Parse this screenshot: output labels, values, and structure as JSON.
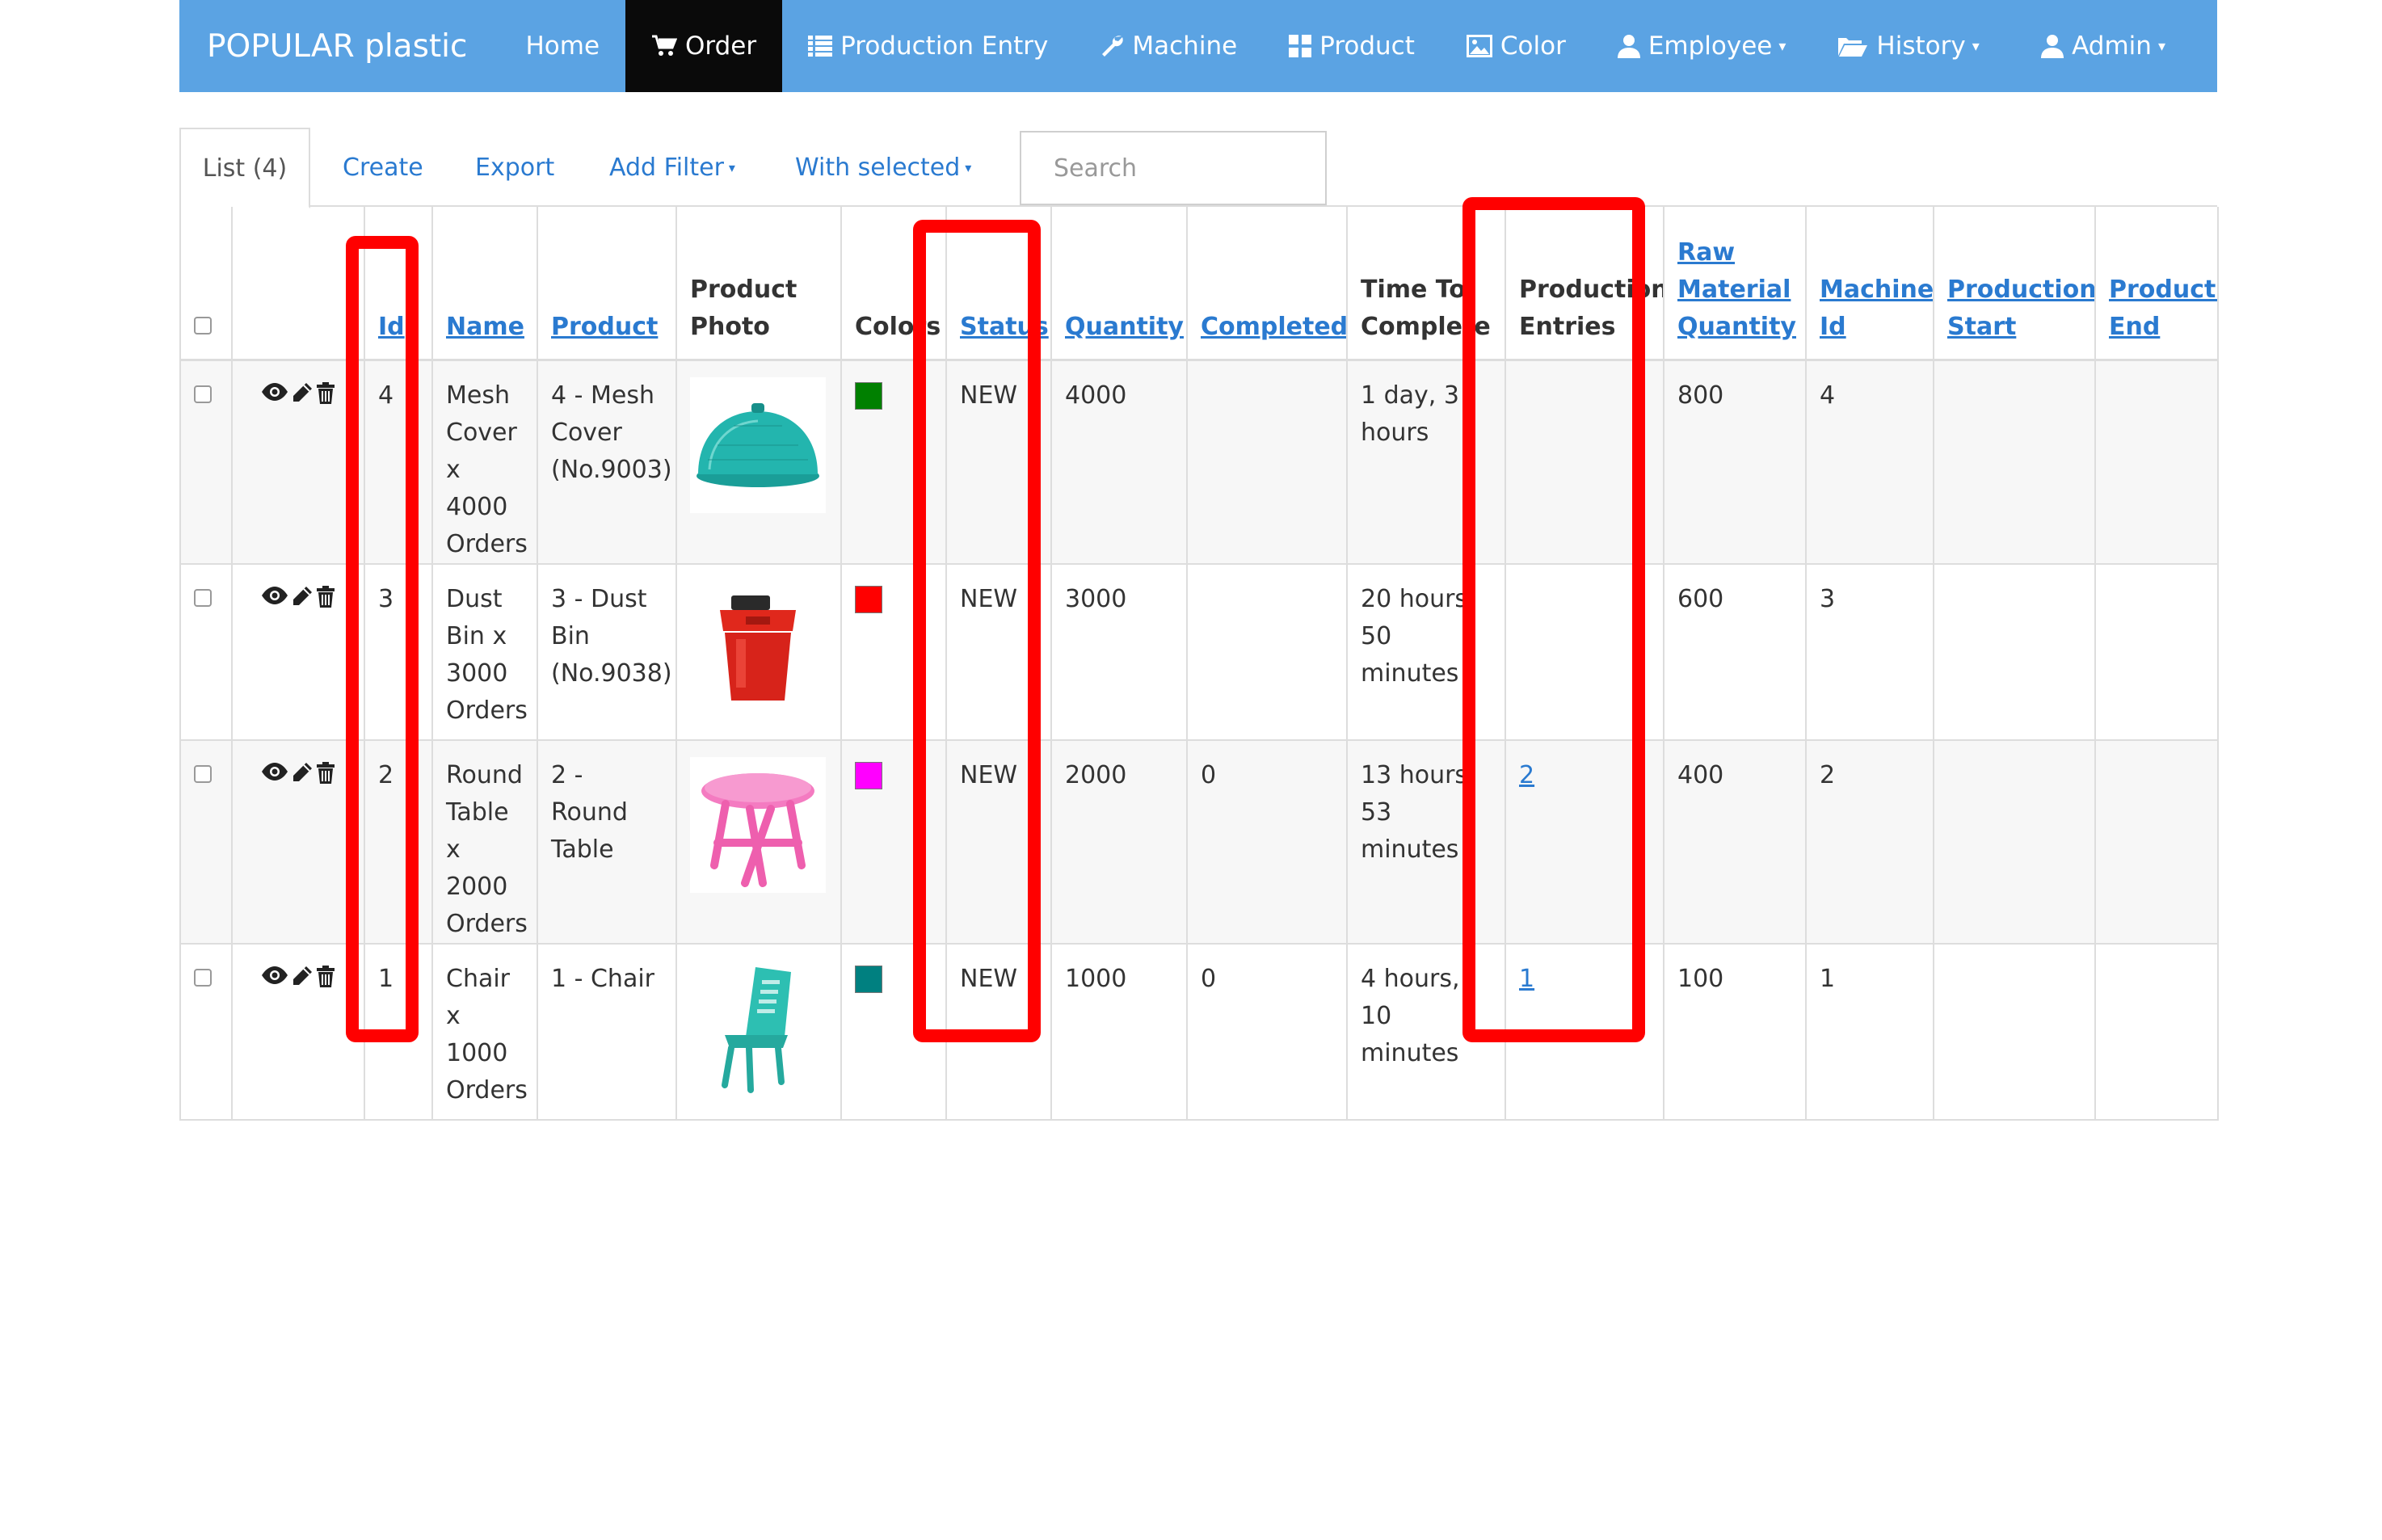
{
  "navbar": {
    "brand": "POPULAR plastic",
    "items": [
      {
        "label": "Home",
        "icon": "",
        "active": false
      },
      {
        "label": "Order",
        "icon": "cart-icon",
        "active": true
      },
      {
        "label": "Production Entry",
        "icon": "list-icon",
        "active": false
      },
      {
        "label": "Machine",
        "icon": "wrench-icon",
        "active": false
      },
      {
        "label": "Product",
        "icon": "grid-icon",
        "active": false
      },
      {
        "label": "Color",
        "icon": "picture-icon",
        "active": false
      },
      {
        "label": "Employee",
        "icon": "user-icon",
        "active": false,
        "dropdown": true
      },
      {
        "label": "History",
        "icon": "folder-icon",
        "active": false,
        "dropdown": true
      }
    ],
    "admin": {
      "label": "Admin",
      "icon": "user-icon",
      "dropdown": true
    },
    "color": "#5ba3e3",
    "active_color": "#0a0a0a"
  },
  "tabs": {
    "list": "List (4)",
    "create": "Create",
    "export": "Export",
    "add_filter": "Add Filter",
    "with_selected": "With selected"
  },
  "search": {
    "placeholder": "Search"
  },
  "table": {
    "headers": {
      "id": "Id",
      "name": "Name",
      "product": "Product",
      "product_photo": "Product Photo",
      "colors": "Colors",
      "status": "Status",
      "quantity": "Quantity",
      "completed": "Completed",
      "time_to_complete": "Time To Complete",
      "production_entries": "Production Entries",
      "raw_material_quantity": "Raw Material Quantity",
      "machine_id": "Machine Id",
      "production_start": "Production Start",
      "production_end": "Production End"
    },
    "rows": [
      {
        "id": "4",
        "name": "Mesh Cover x 4000 Orders",
        "product": "4 - Mesh Cover (No.9003)",
        "photo": "mesh-cover-image",
        "color": "#008000",
        "status": "NEW",
        "quantity": "4000",
        "completed": "",
        "time_to_complete": "1 day, 3 hours",
        "production_entries": "",
        "raw_material_quantity": "800",
        "machine_id": "4",
        "production_start": "",
        "production_end": ""
      },
      {
        "id": "3",
        "name": "Dust Bin x 3000 Orders",
        "product": "3 - Dust Bin (No.9038)",
        "photo": "dust-bin-image",
        "color": "#ff0000",
        "status": "NEW",
        "quantity": "3000",
        "completed": "",
        "time_to_complete": "20 hours, 50 minutes",
        "production_entries": "",
        "raw_material_quantity": "600",
        "machine_id": "3",
        "production_start": "",
        "production_end": ""
      },
      {
        "id": "2",
        "name": "Round Table x 2000 Orders",
        "product": "2 - Round Table",
        "photo": "round-table-image",
        "color": "#ff00ff",
        "status": "NEW",
        "quantity": "2000",
        "completed": "0",
        "time_to_complete": "13 hours, 53 minutes",
        "production_entries": "2",
        "raw_material_quantity": "400",
        "machine_id": "2",
        "production_start": "",
        "production_end": ""
      },
      {
        "id": "1",
        "name": "Chair x 1000 Orders",
        "product": "1 - Chair",
        "photo": "chair-image",
        "color": "#008080",
        "status": "NEW",
        "quantity": "1000",
        "completed": "0",
        "time_to_complete": "4 hours, 10 minutes",
        "production_entries": "1",
        "raw_material_quantity": "100",
        "machine_id": "1",
        "production_start": "",
        "production_end": ""
      }
    ]
  },
  "highlight_color": "#ff0000"
}
